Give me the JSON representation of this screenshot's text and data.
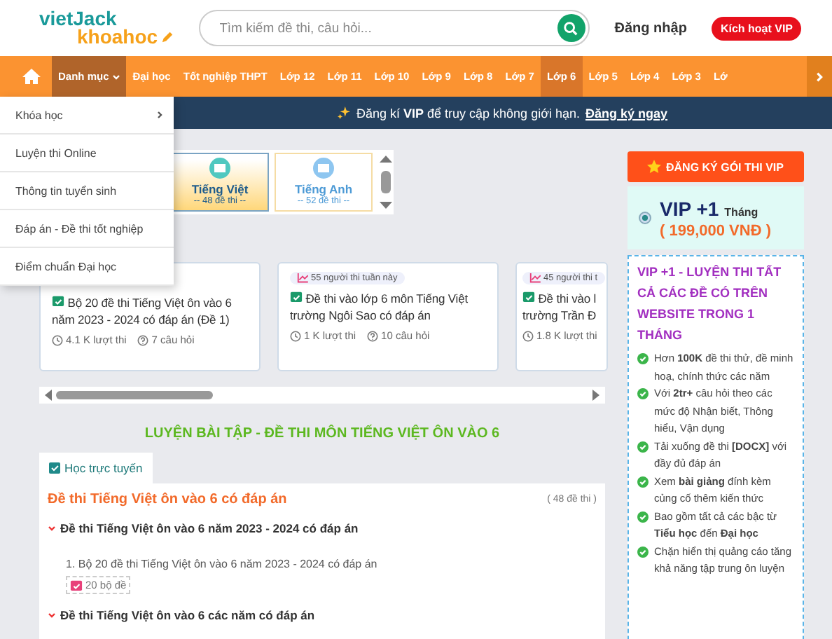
{
  "header": {
    "logo": {
      "top": "vietJack",
      "bottom": "khoahoc"
    },
    "search": {
      "placeholder": "Tìm kiếm đề thi, câu hỏi..."
    },
    "login": "Đăng nhập",
    "vip_button": "Kích hoạt VIP"
  },
  "nav": {
    "items": [
      {
        "label": "Danh mục",
        "kind": "dropdown",
        "expanded": true,
        "selected": false
      },
      {
        "label": "Đại học",
        "kind": "link",
        "selected": false
      },
      {
        "label": "Tốt nghiệp THPT",
        "kind": "link",
        "selected": false
      },
      {
        "label": "Lớp 12",
        "kind": "link",
        "selected": false
      },
      {
        "label": "Lớp 11",
        "kind": "link",
        "selected": false
      },
      {
        "label": "Lớp 10",
        "kind": "link",
        "selected": false
      },
      {
        "label": "Lớp 9",
        "kind": "link",
        "selected": false
      },
      {
        "label": "Lớp 8",
        "kind": "link",
        "selected": false
      },
      {
        "label": "Lớp 7",
        "kind": "link",
        "selected": false
      },
      {
        "label": "Lớp 6",
        "kind": "link",
        "selected": true
      },
      {
        "label": "Lớp 5",
        "kind": "link",
        "selected": false
      },
      {
        "label": "Lớp 4",
        "kind": "link",
        "selected": false
      },
      {
        "label": "Lớp 3",
        "kind": "link",
        "selected": false
      },
      {
        "label": "Lớ",
        "kind": "link",
        "selected": false
      }
    ]
  },
  "banner": {
    "text": "Đăng kí **VIP** để truy cập không giới hạn.",
    "link": "Đăng ký ngay"
  },
  "menu": {
    "items": [
      {
        "label": "Khóa học",
        "has_submenu": true
      },
      {
        "label": "Luyện thi Online",
        "has_submenu": false
      },
      {
        "label": "Thông tin tuyển sinh",
        "has_submenu": false
      },
      {
        "label": "Đáp án - Đề thi tốt nghiệp",
        "has_submenu": false
      },
      {
        "label": "Điểm chuẩn Đại học",
        "has_submenu": false
      }
    ]
  },
  "subjects": [
    {
      "name": "Tiếng Việt",
      "count": "-- 48 đề thi --",
      "selected": true
    },
    {
      "name": "Tiếng Anh",
      "count": "-- 52 đề thi --",
      "selected": false
    }
  ],
  "cards": [
    {
      "title": "Bộ 20 đề thi Tiếng Việt ôn vào 6 năm 2023 - 2024 có đáp án (Đề 1)",
      "views": "4.1 K lượt thi",
      "questions": "7 câu hỏi"
    },
    {
      "badge": "55 người thi tuần này",
      "title": "Đề thi vào lớp 6 môn Tiếng Việt trường Ngôi Sao có đáp án",
      "views": "1 K lượt thi",
      "questions": "10 câu hỏi"
    },
    {
      "badge": "45 người thi t",
      "title": "Đề thi vào l trường Trần Đ",
      "views": "1.8 K lượt thi"
    }
  ],
  "section_title": "LUYỆN BÀI TẬP - ĐỀ THI MÔN TIẾNG VIỆT ÔN VÀO 6",
  "tabs": [
    {
      "label": "Học trực tuyến",
      "selected": true
    }
  ],
  "panel": {
    "title": "Đề thi Tiếng Việt ôn vào 6 có đáp án",
    "count": "( 48 đề thi )",
    "groups": [
      {
        "title": "Đề thi Tiếng Việt ôn vào 6 năm 2023 - 2024 có đáp án",
        "expanded": true,
        "items": [
          {
            "title": "1. Bộ 20 đề thi Tiếng Việt ôn vào 6 năm 2023 - 2024 có đáp án",
            "tag": "20 bộ đề"
          }
        ]
      },
      {
        "title": "Đề thi Tiếng Việt ôn vào 6 các năm có đáp án",
        "expanded": true
      }
    ]
  },
  "vip": {
    "button": "ĐĂNG KÝ GÓI THI VIP",
    "plan": {
      "name": "VIP +1",
      "unit": "Tháng",
      "price": "( 199,000 VNĐ )",
      "selected": true
    },
    "title": "VIP +1 - LUYỆN THI TẤT CẢ CÁC ĐỀ CÓ TRÊN WEBSITE TRONG 1 THÁNG",
    "features": [
      "Hơn **100K** đề thi thử, đề minh hoạ, chính thức các năm",
      "Với **2tr+** câu hỏi theo các mức độ Nhận biết, Thông hiểu, Vận dụng",
      "Tải xuống đề thi **[DOCX]** với đầy đủ đáp án",
      "Xem **bài giảng** đính kèm củng cố thêm kiến thức",
      "Bao gồm tất cả các bậc từ **Tiểu học** đến **Đại học**",
      "Chặn hiển thị quảng cáo tăng khả năng tập trung ôn luyện"
    ]
  }
}
